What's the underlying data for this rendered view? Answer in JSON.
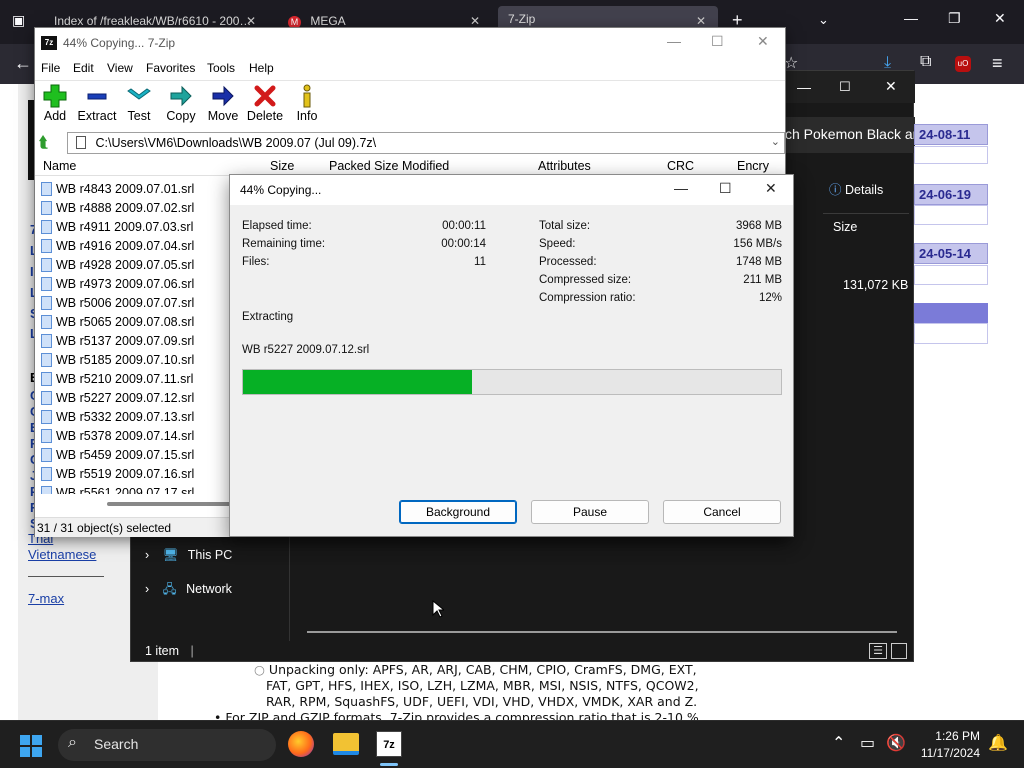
{
  "browser": {
    "tabs": [
      {
        "label": "Index of /freakleak/WB/r6610 - 200…",
        "active": false
      },
      {
        "label": "MEGA",
        "active": false
      },
      {
        "label": "7-Zip",
        "active": true
      }
    ],
    "new_tab": "+"
  },
  "webpage": {
    "dates": [
      "24-08-11",
      "24-06-19",
      "24-05-14"
    ],
    "search_text": "ch Pokemon Black ar",
    "left_links": [
      "Thai",
      "Vietnamese",
      "7-max"
    ],
    "bottom_text": {
      "line1": "Unpacking only: APFS, AR, ARJ, CAB, CHM, CPIO, CramFS, DMG, EXT,",
      "line2": "FAT, GPT, HFS, IHEX, ISO, LZH, LZMA, MBR, MSI, NSIS, NTFS, QCOW2,",
      "line3": "RAR, RPM, SquashFS, UDF, UEFI, VDI, VHD, VHDX, VMDK, XAR and Z.",
      "line4": "For ZIP and GZIP formats, 7-Zip provides a compression ratio that is 2-10 %"
    }
  },
  "explorer": {
    "details_label": "Details",
    "size_header": "Size",
    "size_value": "131,072 KB",
    "nav_items": [
      "This PC",
      "Network"
    ],
    "status": "1 item"
  },
  "zip": {
    "title": "44% Copying... 7-Zip",
    "menu": [
      "File",
      "Edit",
      "View",
      "Favorites",
      "Tools",
      "Help"
    ],
    "tools": [
      "Add",
      "Extract",
      "Test",
      "Copy",
      "Move",
      "Delete",
      "Info"
    ],
    "path": "C:\\Users\\VM6\\Downloads\\WB 2009.07 (Jul 09).7z\\",
    "columns": [
      "Name",
      "Size",
      "Packed Size",
      "Modified",
      "Attributes",
      "CRC",
      "Encry"
    ],
    "files": [
      "WB r4843 2009.07.01.srl",
      "WB r4888 2009.07.02.srl",
      "WB r4911 2009.07.03.srl",
      "WB r4916 2009.07.04.srl",
      "WB r4928 2009.07.05.srl",
      "WB r4973 2009.07.06.srl",
      "WB r5006 2009.07.07.srl",
      "WB r5065 2009.07.08.srl",
      "WB r5137 2009.07.09.srl",
      "WB r5185 2009.07.10.srl",
      "WB r5210 2009.07.11.srl",
      "WB r5227 2009.07.12.srl",
      "WB r5332 2009.07.13.srl",
      "WB r5378 2009.07.14.srl",
      "WB r5459 2009.07.15.srl",
      "WB r5519 2009.07.16.srl",
      "WB r5561 2009.07.17.srl"
    ],
    "status": "31 / 31 object(s) selected"
  },
  "dialog": {
    "title": "44% Copying...",
    "elapsed_label": "Elapsed time:",
    "elapsed_value": "00:00:11",
    "remaining_label": "Remaining time:",
    "remaining_value": "00:00:14",
    "files_label": "Files:",
    "files_value": "11",
    "total_label": "Total size:",
    "total_value": "3968 MB",
    "speed_label": "Speed:",
    "speed_value": "156 MB/s",
    "processed_label": "Processed:",
    "processed_value": "1748 MB",
    "compressed_label": "Compressed size:",
    "compressed_value": "211 MB",
    "ratio_label": "Compression ratio:",
    "ratio_value": "12%",
    "operation": "Extracting",
    "current_file": "WB r5227 2009.07.12.srl",
    "progress_fraction": 0.426,
    "progress_color": "#06b025",
    "buttons": {
      "background": "Background",
      "pause": "Pause",
      "cancel": "Cancel"
    }
  },
  "taskbar": {
    "search_label": "Search",
    "time": "1:26 PM",
    "date": "11/17/2024"
  }
}
